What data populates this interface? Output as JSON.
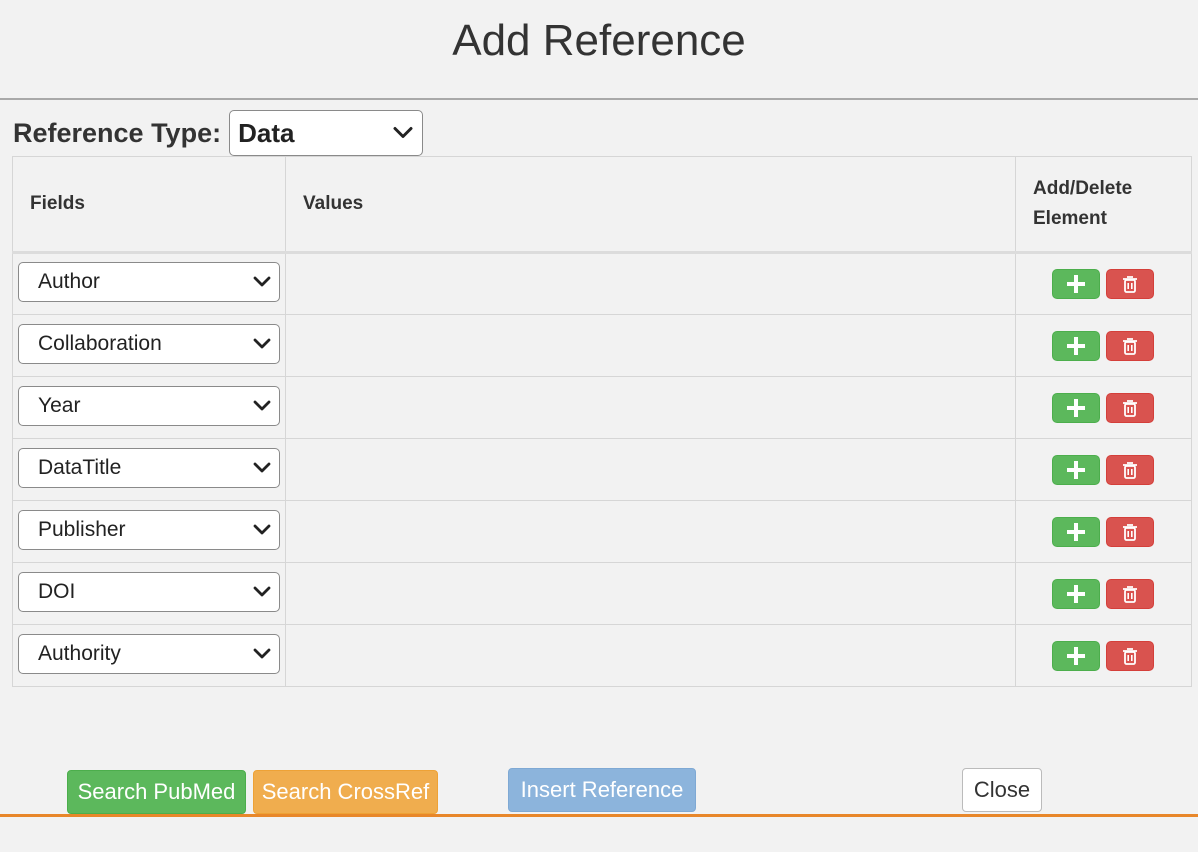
{
  "dialog": {
    "title": "Add Reference"
  },
  "reference_type": {
    "label": "Reference Type:",
    "selected": "Data"
  },
  "table": {
    "headers": {
      "fields": "Fields",
      "values": "Values",
      "actions_line1": "Add/Delete",
      "actions_line2": "Element"
    },
    "rows": [
      {
        "field": "Author",
        "value": ""
      },
      {
        "field": "Collaboration",
        "value": ""
      },
      {
        "field": "Year",
        "value": ""
      },
      {
        "field": "DataTitle",
        "value": ""
      },
      {
        "field": "Publisher",
        "value": ""
      },
      {
        "field": "DOI",
        "value": ""
      },
      {
        "field": "Authority",
        "value": ""
      }
    ]
  },
  "buttons": {
    "search_pubmed": "Search PubMed",
    "search_crossref": "Search CrossRef",
    "insert_reference": "Insert Reference",
    "close": "Close"
  },
  "icons": {
    "add": "plus-icon",
    "delete": "trash-icon",
    "dropdown": "chevron-down-icon"
  },
  "colors": {
    "add": "#5cb85c",
    "delete": "#d9534f",
    "search_crossref": "#f0ad4e",
    "insert": "#8cb4dc",
    "footer_line": "#e8872a"
  }
}
